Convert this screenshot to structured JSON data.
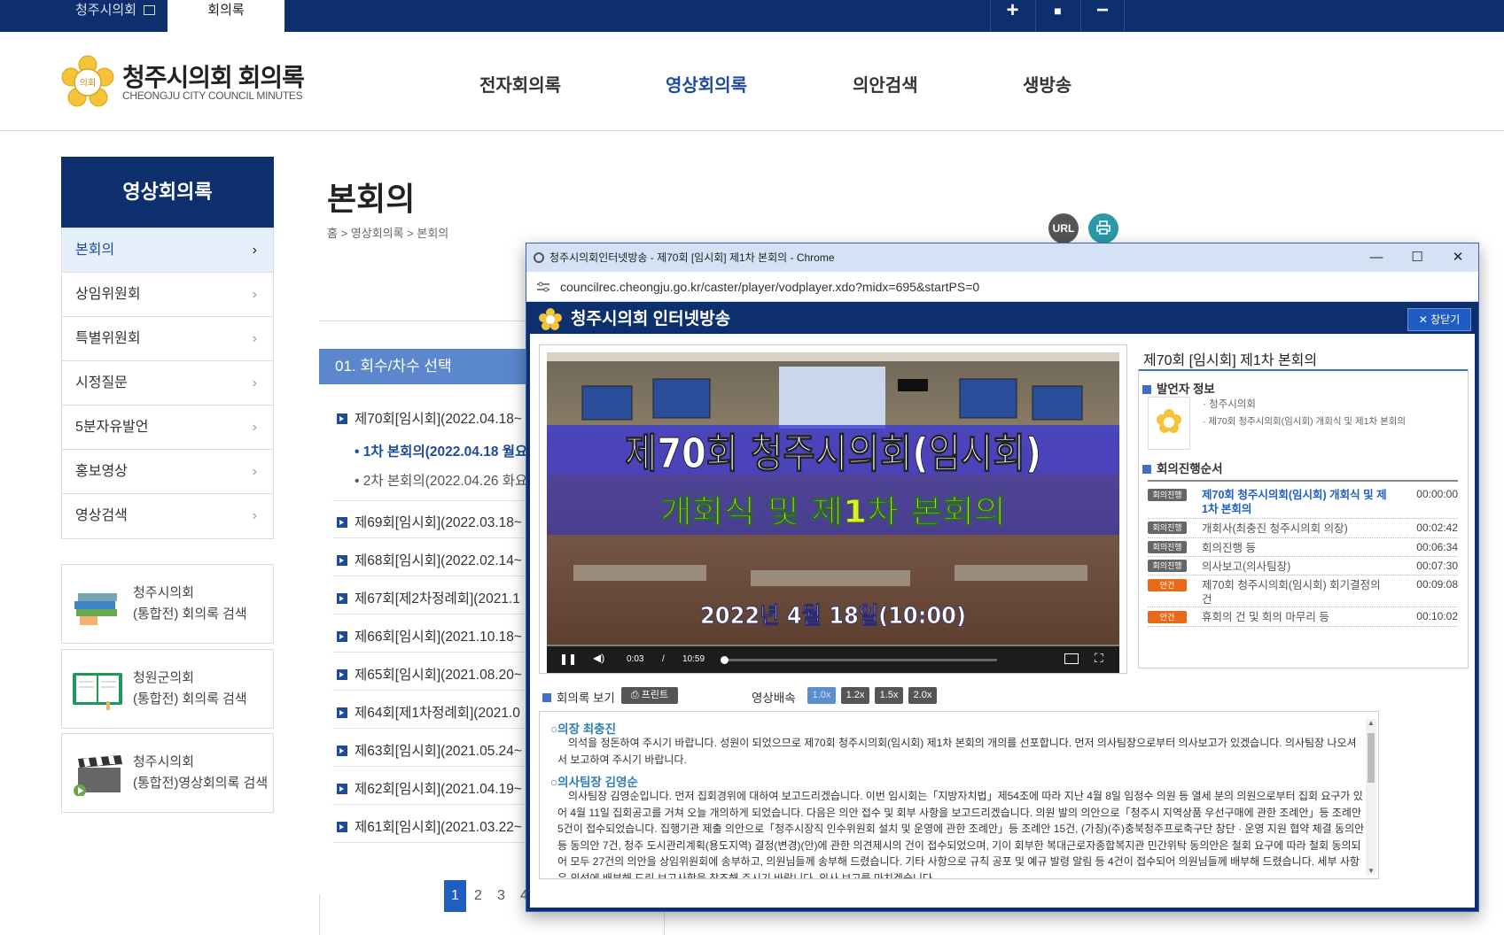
{
  "topbar": {
    "tab1": "청주시의회",
    "tab2": "회의록",
    "btn_plus": "+",
    "btn_stop": "■",
    "btn_minus": "−"
  },
  "header": {
    "seal_text": "의회",
    "title": "청주시의회 회의록",
    "subtitle": "CHEONGJU CITY COUNCIL MINUTES",
    "nav": [
      "전자회의록",
      "영상회의록",
      "의안검색",
      "생방송"
    ]
  },
  "lnb": {
    "title": "영상회의록",
    "items": [
      "본회의",
      "상임위원회",
      "특별위원회",
      "시정질문",
      "5분자유발언",
      "홍보영상",
      "영상검색"
    ]
  },
  "quick": [
    {
      "line1": "청주시의회",
      "line2": "(통합전) 회의록 검색"
    },
    {
      "line1": "청원군의회",
      "line2": "(통합전) 회의록 검색"
    },
    {
      "line1": "청주시의회",
      "line2": "(통합전)영상회의록 검색"
    }
  ],
  "main": {
    "title": "본회의",
    "breadcrumb": "홈 > 영상회의록 > 본회의",
    "url_btn": "URL",
    "section_title": "01. 회수/차수 선택",
    "sessions": [
      "제70회[임시회](2022.04.18~",
      "제69회[임시회](2022.03.18~",
      "제68회[임시회](2022.02.14~",
      "제67회[제2차정례회](2021.1",
      "제66회[임시회](2021.10.18~",
      "제65회[임시회](2021.08.20~",
      "제64회[제1차정례회](2021.0",
      "제63회[임시회](2021.05.24~",
      "제62회[임시회](2021.04.19~",
      "제61회[임시회](2021.03.22~"
    ],
    "sub_sessions": [
      "1차 본회의(2022.04.18 월요",
      "2차 본회의(2022.04.26 화요"
    ],
    "pages": [
      "1",
      "2",
      "3",
      "4"
    ]
  },
  "popup": {
    "window_title": "청주시의회인터넷방송 - 제70회 [임시회] 제1차 본회의 - Chrome",
    "address": "councilrec.cheongju.go.kr/caster/player/vodplayer.xdo?midx=695&startPS=0",
    "brand": "청주시의회 인터넷방송",
    "close_label": "창닫기",
    "video": {
      "headline": "제70회 청주시의회(임시회)",
      "subline": "개회식 및 제1차 본회의",
      "date": "2022년 4월 18일(10:00)",
      "current_time": "0:03",
      "separator": "/",
      "duration": "10:59",
      "progress": 0.005
    },
    "right_title": "제70회 [임시회] 제1차 본회의",
    "speaker_head": "발언자 정보",
    "speaker_lines": [
      "청주시의회",
      "제70회 청주시의회(임시회) 개회식 및 제1차 본회의"
    ],
    "agenda_head": "회의진행순서",
    "agenda": [
      {
        "badge": "회의진행",
        "kind": "gray",
        "text": "제70회 청주시의회(임시회) 개회식 및 제1차 본회의",
        "time": "00:00:00",
        "active": true
      },
      {
        "badge": "회의진행",
        "kind": "gray",
        "text": "개회사(최충진 청주시의회 의장)",
        "time": "00:02:42"
      },
      {
        "badge": "회의진행",
        "kind": "gray",
        "text": "회의진행 등",
        "time": "00:06:34"
      },
      {
        "badge": "회의진행",
        "kind": "gray",
        "text": "의사보고(의사팀장)",
        "time": "00:07:30"
      },
      {
        "badge": "안건",
        "kind": "orange",
        "text": "제70회 청주시의회(임시회) 회기결정의 건",
        "time": "00:09:08"
      },
      {
        "badge": "안건",
        "kind": "orange",
        "text": "휴회의 건 및 회의 마무리 등",
        "time": "00:10:02"
      }
    ],
    "minutes_label": "회의록 보기",
    "print_label": "프린트",
    "speed_label": "영상배속",
    "speeds": [
      "1.0x",
      "1.2x",
      "1.5x",
      "2.0x"
    ],
    "transcript": [
      {
        "speaker": "○의장 최충진",
        "text": "의석을 정돈하여 주시기 바랍니다. 성원이 되었으므로 제70회 청주시의회(임시회) 제1차 본회의 개의를 선포합니다. 먼저 의사팀장으로부터 의사보고가 있겠습니다. 의사팀장 나오셔서 보고하여 주시기 바랍니다."
      },
      {
        "speaker": "○의사팀장 김영순",
        "text": "의사팀장 김영순입니다. 먼저 집회경위에 대하여 보고드리겠습니다. 이번 임시회는「지방자치법」제54조에 따라 지난 4월 8일 임정수 의원 등 열세 분의 의원으로부터 집회 요구가 있어 4월 11일 집회공고를 거쳐 오늘 개의하게 되었습니다. 다음은 의안 접수 및 회부 사항을 보고드리겠습니다. 의원 발의 의안으로「청주시 지역상품 우선구매에 관한 조례안」등 조례안 5건이 접수되었습니다. 집행기관 제출 의안으로「청주시장직 인수위원회 설치 및 운영에 관한 조례안」등 조례안 15건, (가칭)(주)충북청주프로축구단 창단 · 운영 지원 협약 체결 동의안 등 동의안 7건, 청주 도시관리계획(용도지역) 결정(변경)(안)에 관한 의견제시의 건이 접수되었으며, 기이 회부한 복대근로자종합복지관 민간위탁 동의안은 철회 요구에 따라 철회 동의되어 모두 27건의 의안을 상임위원회에 송부하고, 의원님들께 송부해 드렸습니다. 기타 사항으로 규칙 공포 및 예규 발령 알림 등 4건이 접수되어 의원님들께 배부해 드렸습니다. 세부 사항은 의석에 배부해 드린 보고사항을 참조해 주시기 바랍니다. 의사 보고를 마치겠습니다."
      }
    ]
  }
}
